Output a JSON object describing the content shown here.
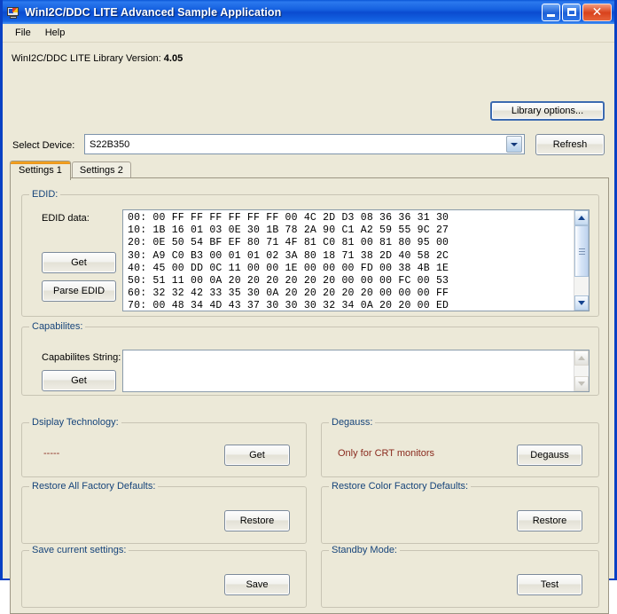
{
  "window": {
    "title": "WinI2C/DDC LITE Advanced Sample Application",
    "icon": "monitor-icon",
    "minimize_label": "_",
    "maximize_label": "",
    "close_label": "✕"
  },
  "menubar": {
    "items": [
      {
        "label": "File"
      },
      {
        "label": "Help"
      }
    ]
  },
  "header": {
    "version_label": "WinI2C/DDC LITE Library Version:",
    "version_value": "4.05",
    "library_options_button": "Library options...",
    "select_device_label": "Select Device:",
    "selected_device": "S22B350",
    "device_dropdown_icon": "chevron-down-icon",
    "refresh_button": "Refresh"
  },
  "tabs": [
    {
      "label": "Settings 1",
      "active": true
    },
    {
      "label": "Settings 2",
      "active": false
    }
  ],
  "groups": {
    "edid": {
      "title": "EDID:",
      "data_label": "EDID data:",
      "get_button": "Get",
      "parse_button": "Parse EDID",
      "hex_rows": [
        "00: 00 FF FF FF FF FF FF 00 4C 2D D3 08 36 36 31 30",
        "10: 1B 16 01 03 0E 30 1B 78 2A 90 C1 A2 59 55 9C 27",
        "20: 0E 50 54 BF EF 80 71 4F 81 C0 81 00 81 80 95 00",
        "30: A9 C0 B3 00 01 01 02 3A 80 18 71 38 2D 40 58 2C",
        "40: 45 00 DD 0C 11 00 00 1E 00 00 00 FD 00 38 4B 1E",
        "50: 51 11 00 0A 20 20 20 20 20 20 00 00 00 FC 00 53",
        "60: 32 32 42 33 35 30 0A 20 20 20 20 20 00 00 00 FF",
        "70: 00 48 34 4D 43 37 30 30 30 32 34 0A 20 20 00 ED"
      ],
      "scrollbar": {
        "up_icon": "scroll-up-icon",
        "down_icon": "scroll-down-icon",
        "enabled": true
      }
    },
    "capabilities": {
      "title": "Capabilites:",
      "string_label": "Capabilites String:",
      "string_value": "",
      "get_button": "Get",
      "scrollbar": {
        "up_icon": "scroll-up-icon",
        "down_icon": "scroll-down-icon",
        "enabled": false
      }
    },
    "display_technology": {
      "title": "Dsiplay Technology:",
      "value": "-----",
      "get_button": "Get"
    },
    "degauss": {
      "title": "Degauss:",
      "note": "Only for CRT monitors",
      "button": "Degauss"
    },
    "restore_all": {
      "title": "Restore All Factory Defaults:",
      "button": "Restore"
    },
    "restore_color": {
      "title": "Restore Color Factory Defaults:",
      "button": "Restore"
    },
    "save_settings": {
      "title": "Save current settings:",
      "button": "Save"
    },
    "standby": {
      "title": "Standby Mode:",
      "button": "Test"
    }
  },
  "colors": {
    "titlebar_blue": "#1560e0",
    "group_title": "#16447a",
    "note_red": "#8a2a1e",
    "window_face": "#ece9d8",
    "tab_accent": "#f5a623"
  }
}
